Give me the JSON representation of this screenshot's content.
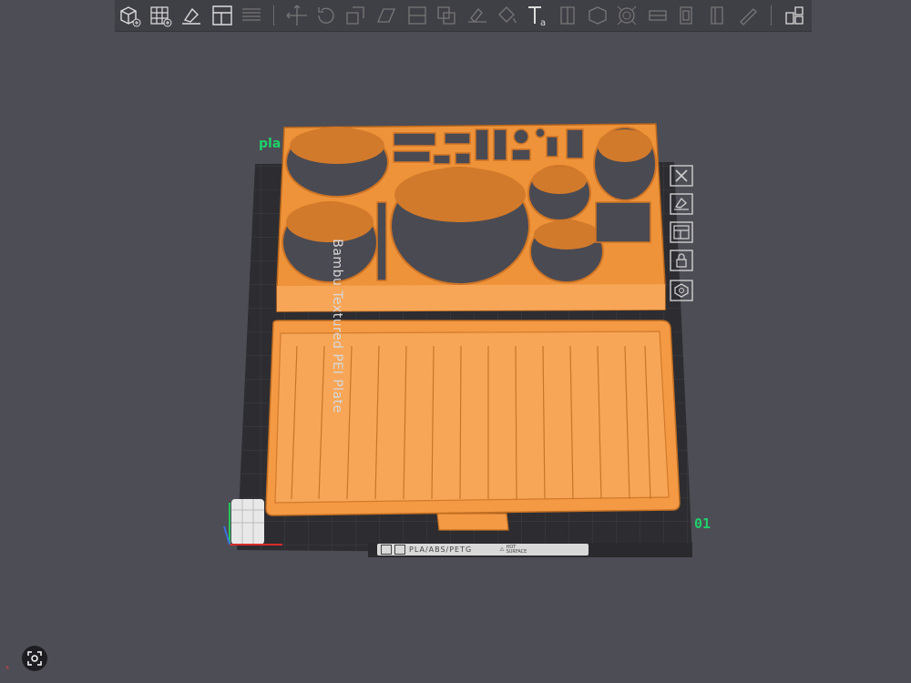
{
  "toolbar": {
    "buttons": [
      {
        "name": "add-object-button",
        "icon": "cube-plus-icon"
      },
      {
        "name": "add-plate-button",
        "icon": "grid-plus-icon"
      },
      {
        "name": "auto-orient-button",
        "icon": "orient-icon"
      },
      {
        "name": "arrange-button",
        "icon": "arrange-icon"
      },
      {
        "name": "split-button",
        "icon": "lines-icon"
      },
      {
        "name": "move-button",
        "icon": "move-icon"
      },
      {
        "name": "rotate-button",
        "icon": "rotate-icon"
      },
      {
        "name": "scale-button",
        "icon": "scale-icon"
      },
      {
        "name": "lay-on-face-button",
        "icon": "face-icon"
      },
      {
        "name": "cut-button",
        "icon": "cut-icon"
      },
      {
        "name": "boolean-button",
        "icon": "boolean-icon"
      },
      {
        "name": "support-paint-button",
        "icon": "brush-icon"
      },
      {
        "name": "color-paint-button",
        "icon": "bucket-icon"
      },
      {
        "name": "text-button",
        "icon": "text-icon"
      },
      {
        "name": "seam-button",
        "icon": "seam-icon"
      },
      {
        "name": "mesh-button",
        "icon": "mesh-icon"
      },
      {
        "name": "hollow-button",
        "icon": "hollow-icon"
      },
      {
        "name": "measure-button",
        "icon": "measure-icon"
      },
      {
        "name": "assembly-button",
        "icon": "assembly-icon"
      },
      {
        "name": "variable-layer-button",
        "icon": "layers-icon"
      },
      {
        "name": "ruler-button",
        "icon": "ruler-icon"
      },
      {
        "name": "explode-button",
        "icon": "explode-icon"
      }
    ]
  },
  "plate": {
    "name": "Bambu Textured PEI Plate",
    "label": "pla",
    "number": "01",
    "material_strip": "PLA/ABS/PETG",
    "warning": "HOT SURFACE"
  },
  "colors": {
    "background": "#4d4d55",
    "plate": "#2f2f33",
    "model": "#f49a45",
    "model_shadow": "#c26e22",
    "accent_green": "#1fd16a"
  },
  "side_tools": [
    {
      "name": "close-plate-button",
      "icon": "close-icon"
    },
    {
      "name": "auto-orient-plate-button",
      "icon": "orient-icon"
    },
    {
      "name": "arrange-plate-button",
      "icon": "arrange-icon"
    },
    {
      "name": "lock-plate-button",
      "icon": "lock-icon"
    },
    {
      "name": "plate-settings-button",
      "icon": "gear-icon"
    }
  ]
}
